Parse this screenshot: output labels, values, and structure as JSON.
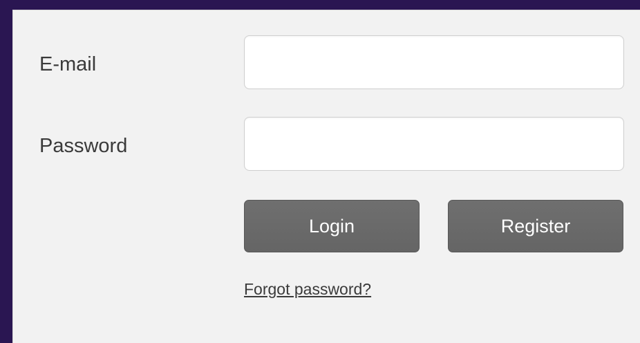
{
  "form": {
    "email_label": "E-mail",
    "email_value": "",
    "password_label": "Password",
    "password_value": "",
    "login_label": "Login",
    "register_label": "Register",
    "forgot_label": "Forgot password?"
  },
  "colors": {
    "frame_background": "#2a1652",
    "panel_background": "#f2f2f2",
    "button_background": "#6a6a6a",
    "button_text": "#ffffff",
    "label_text": "#3a3a3a"
  }
}
